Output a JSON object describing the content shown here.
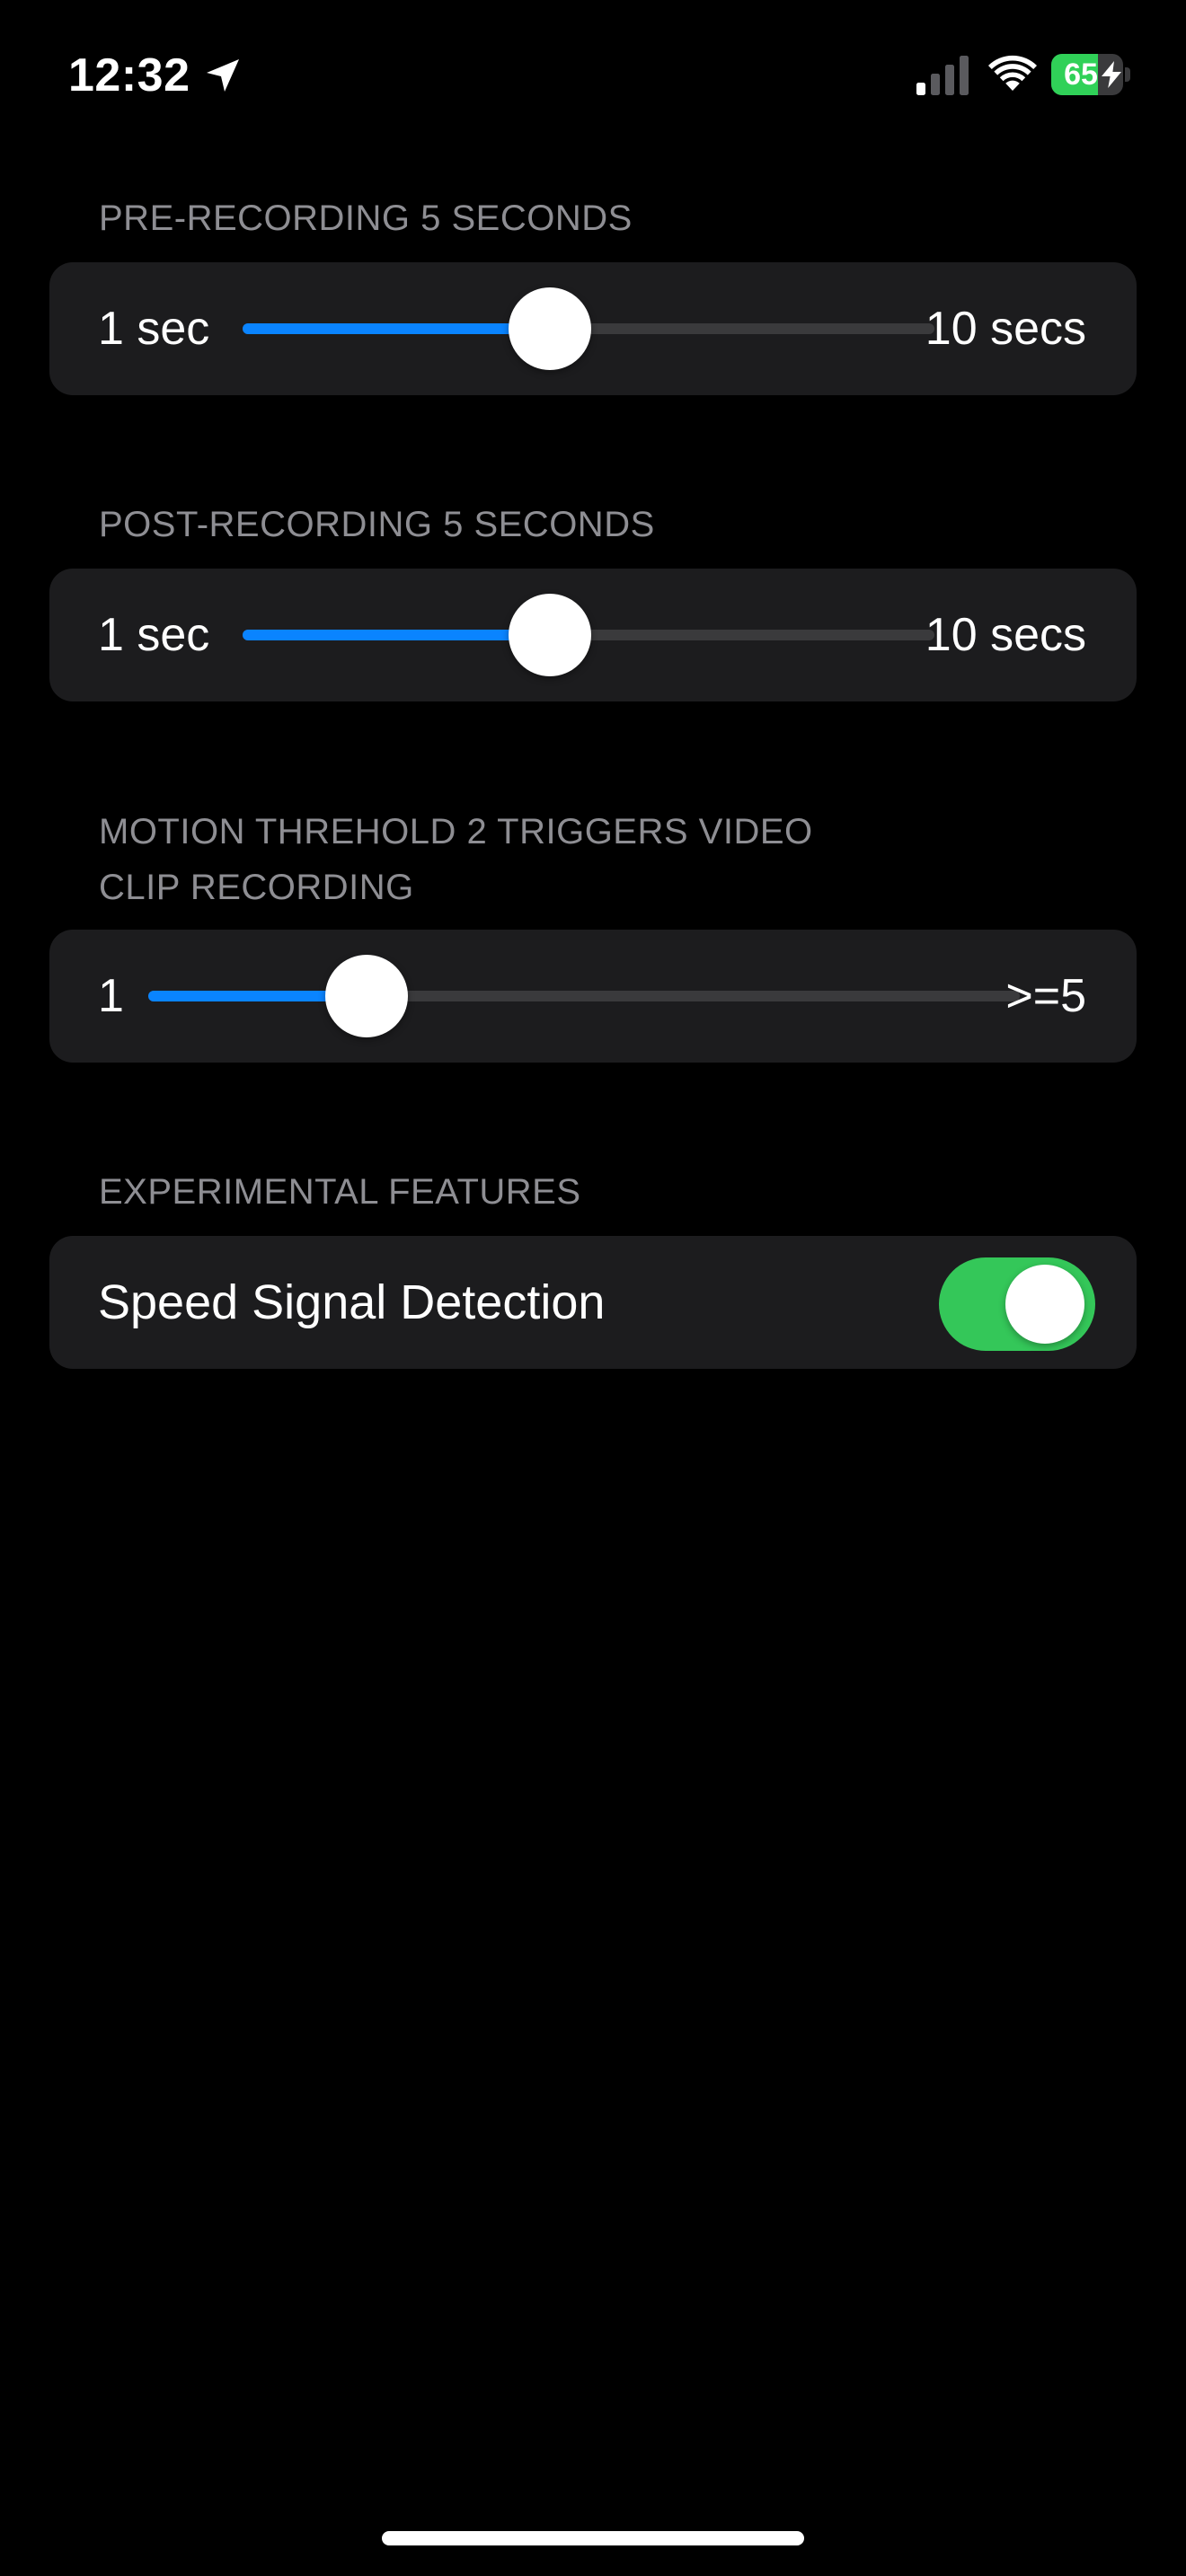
{
  "status_bar": {
    "time": "12:32",
    "location_icon": "location-arrow-icon",
    "signal_icon": "cellular-signal-icon",
    "wifi_icon": "wifi-icon",
    "battery_percent": "65",
    "battery_level": 0.65,
    "battery_icon": "battery-charging-icon",
    "battery_color": "#30d158"
  },
  "pre_recording": {
    "header": "PRE-RECORDING 5 SECONDS",
    "min_label": "1 sec",
    "max_label": "10 secs",
    "min_value": 1,
    "max_value": 10,
    "value": 5
  },
  "post_recording": {
    "header": "POST-RECORDING 5 SECONDS",
    "min_label": "1 sec",
    "max_label": "10 secs",
    "min_value": 1,
    "max_value": 10,
    "value": 5
  },
  "motion_threshold": {
    "header_line1": "MOTION THREHOLD 2 TRIGGERS VIDEO",
    "header_line2": "CLIP RECORDING",
    "min_label": "1",
    "max_label": ">=5",
    "min_value": 1,
    "max_value": 5,
    "value": 2
  },
  "experimental": {
    "header": "EXPERIMENTAL FEATURES",
    "speed_signal_label": "Speed Signal Detection",
    "speed_signal_enabled": true
  },
  "colors": {
    "background": "#000000",
    "card": "#1c1c1e",
    "accent_blue": "#0a84ff",
    "toggle_green": "#34c759",
    "header_gray": "#8e8e93"
  }
}
